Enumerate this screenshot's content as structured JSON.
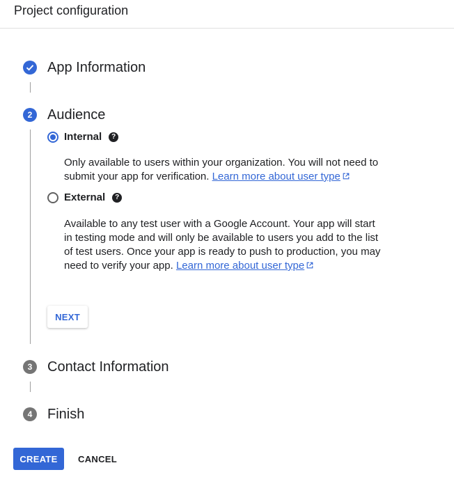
{
  "header": {
    "title": "Project configuration"
  },
  "steps": [
    {
      "number": "✓",
      "title": "App Information",
      "state": "completed"
    },
    {
      "number": "2",
      "title": "Audience",
      "state": "active"
    },
    {
      "number": "3",
      "title": "Contact Information",
      "state": "pending"
    },
    {
      "number": "4",
      "title": "Finish",
      "state": "pending"
    }
  ],
  "audience": {
    "options": [
      {
        "label": "Internal",
        "selected": true,
        "description": "Only available to users within your organization. You will not need to submit your app for verification.",
        "link": "Learn more about user type"
      },
      {
        "label": "External",
        "selected": false,
        "description": "Available to any test user with a Google Account. Your app will start in testing mode and will only be available to users you add to the list of test users. Once your app is ready to push to production, you may need to verify your app.",
        "link": "Learn more about user type"
      }
    ],
    "help_icon": "?",
    "next_label": "NEXT"
  },
  "footer": {
    "create_label": "CREATE",
    "cancel_label": "CANCEL"
  },
  "colors": {
    "accent": "#3367d6",
    "pending": "#757575",
    "text": "#202124"
  },
  "icons": [
    "check-icon",
    "help-icon",
    "external-link-icon"
  ]
}
